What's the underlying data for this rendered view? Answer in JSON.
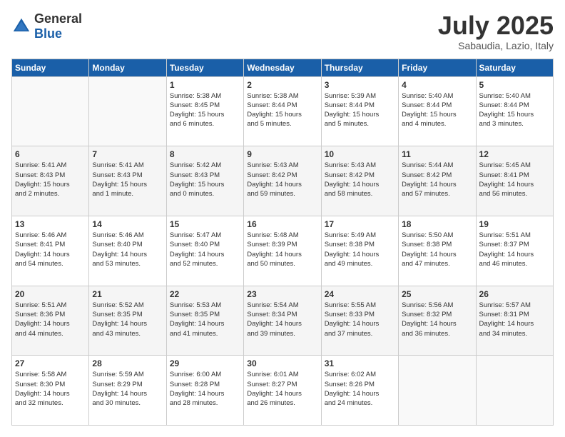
{
  "header": {
    "logo_general": "General",
    "logo_blue": "Blue",
    "month_title": "July 2025",
    "location": "Sabaudia, Lazio, Italy"
  },
  "weekdays": [
    "Sunday",
    "Monday",
    "Tuesday",
    "Wednesday",
    "Thursday",
    "Friday",
    "Saturday"
  ],
  "weeks": [
    [
      {
        "day": "",
        "info": ""
      },
      {
        "day": "",
        "info": ""
      },
      {
        "day": "1",
        "info": "Sunrise: 5:38 AM\nSunset: 8:45 PM\nDaylight: 15 hours\nand 6 minutes."
      },
      {
        "day": "2",
        "info": "Sunrise: 5:38 AM\nSunset: 8:44 PM\nDaylight: 15 hours\nand 5 minutes."
      },
      {
        "day": "3",
        "info": "Sunrise: 5:39 AM\nSunset: 8:44 PM\nDaylight: 15 hours\nand 5 minutes."
      },
      {
        "day": "4",
        "info": "Sunrise: 5:40 AM\nSunset: 8:44 PM\nDaylight: 15 hours\nand 4 minutes."
      },
      {
        "day": "5",
        "info": "Sunrise: 5:40 AM\nSunset: 8:44 PM\nDaylight: 15 hours\nand 3 minutes."
      }
    ],
    [
      {
        "day": "6",
        "info": "Sunrise: 5:41 AM\nSunset: 8:43 PM\nDaylight: 15 hours\nand 2 minutes."
      },
      {
        "day": "7",
        "info": "Sunrise: 5:41 AM\nSunset: 8:43 PM\nDaylight: 15 hours\nand 1 minute."
      },
      {
        "day": "8",
        "info": "Sunrise: 5:42 AM\nSunset: 8:43 PM\nDaylight: 15 hours\nand 0 minutes."
      },
      {
        "day": "9",
        "info": "Sunrise: 5:43 AM\nSunset: 8:42 PM\nDaylight: 14 hours\nand 59 minutes."
      },
      {
        "day": "10",
        "info": "Sunrise: 5:43 AM\nSunset: 8:42 PM\nDaylight: 14 hours\nand 58 minutes."
      },
      {
        "day": "11",
        "info": "Sunrise: 5:44 AM\nSunset: 8:42 PM\nDaylight: 14 hours\nand 57 minutes."
      },
      {
        "day": "12",
        "info": "Sunrise: 5:45 AM\nSunset: 8:41 PM\nDaylight: 14 hours\nand 56 minutes."
      }
    ],
    [
      {
        "day": "13",
        "info": "Sunrise: 5:46 AM\nSunset: 8:41 PM\nDaylight: 14 hours\nand 54 minutes."
      },
      {
        "day": "14",
        "info": "Sunrise: 5:46 AM\nSunset: 8:40 PM\nDaylight: 14 hours\nand 53 minutes."
      },
      {
        "day": "15",
        "info": "Sunrise: 5:47 AM\nSunset: 8:40 PM\nDaylight: 14 hours\nand 52 minutes."
      },
      {
        "day": "16",
        "info": "Sunrise: 5:48 AM\nSunset: 8:39 PM\nDaylight: 14 hours\nand 50 minutes."
      },
      {
        "day": "17",
        "info": "Sunrise: 5:49 AM\nSunset: 8:38 PM\nDaylight: 14 hours\nand 49 minutes."
      },
      {
        "day": "18",
        "info": "Sunrise: 5:50 AM\nSunset: 8:38 PM\nDaylight: 14 hours\nand 47 minutes."
      },
      {
        "day": "19",
        "info": "Sunrise: 5:51 AM\nSunset: 8:37 PM\nDaylight: 14 hours\nand 46 minutes."
      }
    ],
    [
      {
        "day": "20",
        "info": "Sunrise: 5:51 AM\nSunset: 8:36 PM\nDaylight: 14 hours\nand 44 minutes."
      },
      {
        "day": "21",
        "info": "Sunrise: 5:52 AM\nSunset: 8:35 PM\nDaylight: 14 hours\nand 43 minutes."
      },
      {
        "day": "22",
        "info": "Sunrise: 5:53 AM\nSunset: 8:35 PM\nDaylight: 14 hours\nand 41 minutes."
      },
      {
        "day": "23",
        "info": "Sunrise: 5:54 AM\nSunset: 8:34 PM\nDaylight: 14 hours\nand 39 minutes."
      },
      {
        "day": "24",
        "info": "Sunrise: 5:55 AM\nSunset: 8:33 PM\nDaylight: 14 hours\nand 37 minutes."
      },
      {
        "day": "25",
        "info": "Sunrise: 5:56 AM\nSunset: 8:32 PM\nDaylight: 14 hours\nand 36 minutes."
      },
      {
        "day": "26",
        "info": "Sunrise: 5:57 AM\nSunset: 8:31 PM\nDaylight: 14 hours\nand 34 minutes."
      }
    ],
    [
      {
        "day": "27",
        "info": "Sunrise: 5:58 AM\nSunset: 8:30 PM\nDaylight: 14 hours\nand 32 minutes."
      },
      {
        "day": "28",
        "info": "Sunrise: 5:59 AM\nSunset: 8:29 PM\nDaylight: 14 hours\nand 30 minutes."
      },
      {
        "day": "29",
        "info": "Sunrise: 6:00 AM\nSunset: 8:28 PM\nDaylight: 14 hours\nand 28 minutes."
      },
      {
        "day": "30",
        "info": "Sunrise: 6:01 AM\nSunset: 8:27 PM\nDaylight: 14 hours\nand 26 minutes."
      },
      {
        "day": "31",
        "info": "Sunrise: 6:02 AM\nSunset: 8:26 PM\nDaylight: 14 hours\nand 24 minutes."
      },
      {
        "day": "",
        "info": ""
      },
      {
        "day": "",
        "info": ""
      }
    ]
  ]
}
